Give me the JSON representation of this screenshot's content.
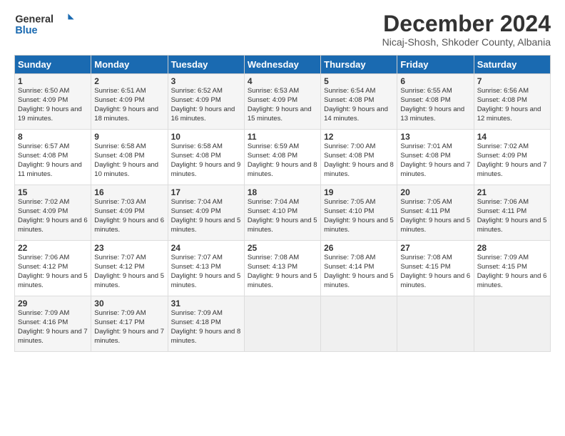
{
  "header": {
    "logo_line1": "General",
    "logo_line2": "Blue",
    "month": "December 2024",
    "location": "Nicaj-Shosh, Shkoder County, Albania"
  },
  "days_of_week": [
    "Sunday",
    "Monday",
    "Tuesday",
    "Wednesday",
    "Thursday",
    "Friday",
    "Saturday"
  ],
  "weeks": [
    [
      {
        "day": "1",
        "sunrise": "6:50 AM",
        "sunset": "4:09 PM",
        "daylight": "9 hours and 19 minutes."
      },
      {
        "day": "2",
        "sunrise": "6:51 AM",
        "sunset": "4:09 PM",
        "daylight": "9 hours and 18 minutes."
      },
      {
        "day": "3",
        "sunrise": "6:52 AM",
        "sunset": "4:09 PM",
        "daylight": "9 hours and 16 minutes."
      },
      {
        "day": "4",
        "sunrise": "6:53 AM",
        "sunset": "4:09 PM",
        "daylight": "9 hours and 15 minutes."
      },
      {
        "day": "5",
        "sunrise": "6:54 AM",
        "sunset": "4:08 PM",
        "daylight": "9 hours and 14 minutes."
      },
      {
        "day": "6",
        "sunrise": "6:55 AM",
        "sunset": "4:08 PM",
        "daylight": "9 hours and 13 minutes."
      },
      {
        "day": "7",
        "sunrise": "6:56 AM",
        "sunset": "4:08 PM",
        "daylight": "9 hours and 12 minutes."
      }
    ],
    [
      {
        "day": "8",
        "sunrise": "6:57 AM",
        "sunset": "4:08 PM",
        "daylight": "9 hours and 11 minutes."
      },
      {
        "day": "9",
        "sunrise": "6:58 AM",
        "sunset": "4:08 PM",
        "daylight": "9 hours and 10 minutes."
      },
      {
        "day": "10",
        "sunrise": "6:58 AM",
        "sunset": "4:08 PM",
        "daylight": "9 hours and 9 minutes."
      },
      {
        "day": "11",
        "sunrise": "6:59 AM",
        "sunset": "4:08 PM",
        "daylight": "9 hours and 8 minutes."
      },
      {
        "day": "12",
        "sunrise": "7:00 AM",
        "sunset": "4:08 PM",
        "daylight": "9 hours and 8 minutes."
      },
      {
        "day": "13",
        "sunrise": "7:01 AM",
        "sunset": "4:08 PM",
        "daylight": "9 hours and 7 minutes."
      },
      {
        "day": "14",
        "sunrise": "7:02 AM",
        "sunset": "4:09 PM",
        "daylight": "9 hours and 7 minutes."
      }
    ],
    [
      {
        "day": "15",
        "sunrise": "7:02 AM",
        "sunset": "4:09 PM",
        "daylight": "9 hours and 6 minutes."
      },
      {
        "day": "16",
        "sunrise": "7:03 AM",
        "sunset": "4:09 PM",
        "daylight": "9 hours and 6 minutes."
      },
      {
        "day": "17",
        "sunrise": "7:04 AM",
        "sunset": "4:09 PM",
        "daylight": "9 hours and 5 minutes."
      },
      {
        "day": "18",
        "sunrise": "7:04 AM",
        "sunset": "4:10 PM",
        "daylight": "9 hours and 5 minutes."
      },
      {
        "day": "19",
        "sunrise": "7:05 AM",
        "sunset": "4:10 PM",
        "daylight": "9 hours and 5 minutes."
      },
      {
        "day": "20",
        "sunrise": "7:05 AM",
        "sunset": "4:11 PM",
        "daylight": "9 hours and 5 minutes."
      },
      {
        "day": "21",
        "sunrise": "7:06 AM",
        "sunset": "4:11 PM",
        "daylight": "9 hours and 5 minutes."
      }
    ],
    [
      {
        "day": "22",
        "sunrise": "7:06 AM",
        "sunset": "4:12 PM",
        "daylight": "9 hours and 5 minutes."
      },
      {
        "day": "23",
        "sunrise": "7:07 AM",
        "sunset": "4:12 PM",
        "daylight": "9 hours and 5 minutes."
      },
      {
        "day": "24",
        "sunrise": "7:07 AM",
        "sunset": "4:13 PM",
        "daylight": "9 hours and 5 minutes."
      },
      {
        "day": "25",
        "sunrise": "7:08 AM",
        "sunset": "4:13 PM",
        "daylight": "9 hours and 5 minutes."
      },
      {
        "day": "26",
        "sunrise": "7:08 AM",
        "sunset": "4:14 PM",
        "daylight": "9 hours and 5 minutes."
      },
      {
        "day": "27",
        "sunrise": "7:08 AM",
        "sunset": "4:15 PM",
        "daylight": "9 hours and 6 minutes."
      },
      {
        "day": "28",
        "sunrise": "7:09 AM",
        "sunset": "4:15 PM",
        "daylight": "9 hours and 6 minutes."
      }
    ],
    [
      {
        "day": "29",
        "sunrise": "7:09 AM",
        "sunset": "4:16 PM",
        "daylight": "9 hours and 7 minutes."
      },
      {
        "day": "30",
        "sunrise": "7:09 AM",
        "sunset": "4:17 PM",
        "daylight": "9 hours and 7 minutes."
      },
      {
        "day": "31",
        "sunrise": "7:09 AM",
        "sunset": "4:18 PM",
        "daylight": "9 hours and 8 minutes."
      },
      null,
      null,
      null,
      null
    ]
  ]
}
